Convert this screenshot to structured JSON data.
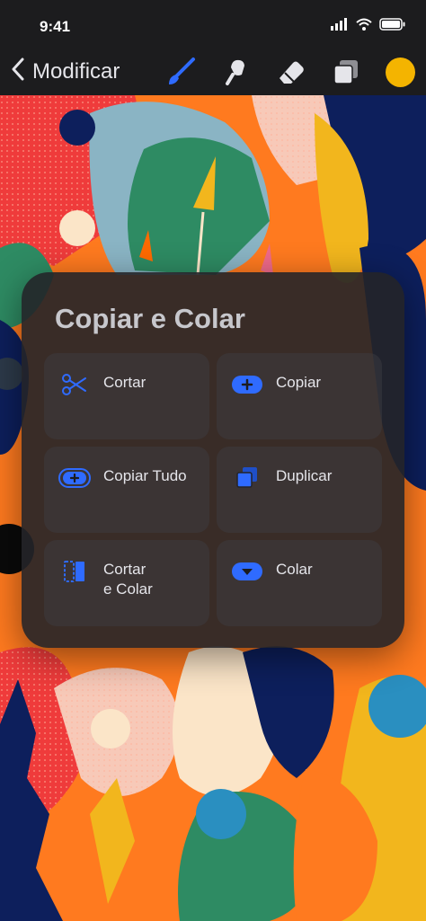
{
  "status_bar": {
    "time": "9:41"
  },
  "toolbar": {
    "back_label": "Modificar",
    "accent_color": "#2f6bff",
    "selected_color": "#f4b400"
  },
  "panel": {
    "title": "Copiar e Colar",
    "actions": [
      {
        "label": "Cortar",
        "icon": "scissors-icon"
      },
      {
        "label": "Copiar",
        "icon": "copy-plus-icon"
      },
      {
        "label": "Copiar Tudo",
        "icon": "copy-all-icon"
      },
      {
        "label": "Duplicar",
        "icon": "duplicate-icon"
      },
      {
        "label": "Cortar",
        "label_line2": "e Colar",
        "icon": "cut-paste-icon"
      },
      {
        "label": "Colar",
        "icon": "paste-down-icon"
      }
    ]
  }
}
